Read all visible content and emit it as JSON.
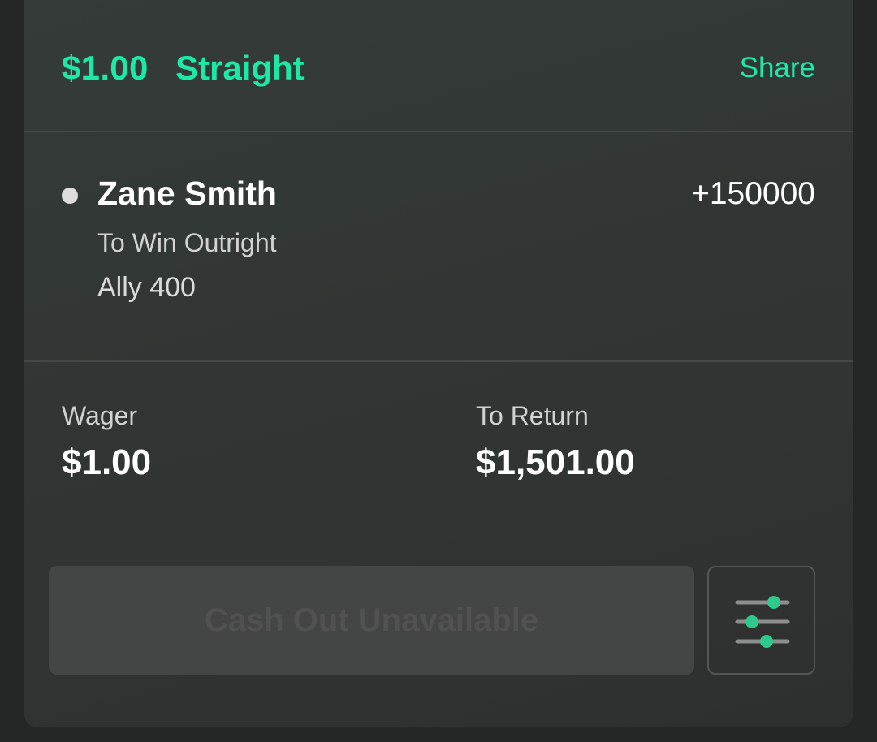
{
  "bet": {
    "stake": "$1.00",
    "type": "Straight",
    "share_label": "Share"
  },
  "selection": {
    "player": "Zane Smith",
    "odds": "+150000",
    "market": "To Win Outright",
    "event": "Ally 400"
  },
  "summary": {
    "wager_label": "Wager",
    "wager_value": "$1.00",
    "return_label": "To Return",
    "return_value": "$1,501.00"
  },
  "actions": {
    "cashout_label": "Cash Out Unavailable",
    "settings_icon": "sliders-icon"
  },
  "colors": {
    "accent": "#1de9a6",
    "slider_knob": "#2ec98f",
    "card_background": "#323735",
    "page_background": "#252626"
  }
}
